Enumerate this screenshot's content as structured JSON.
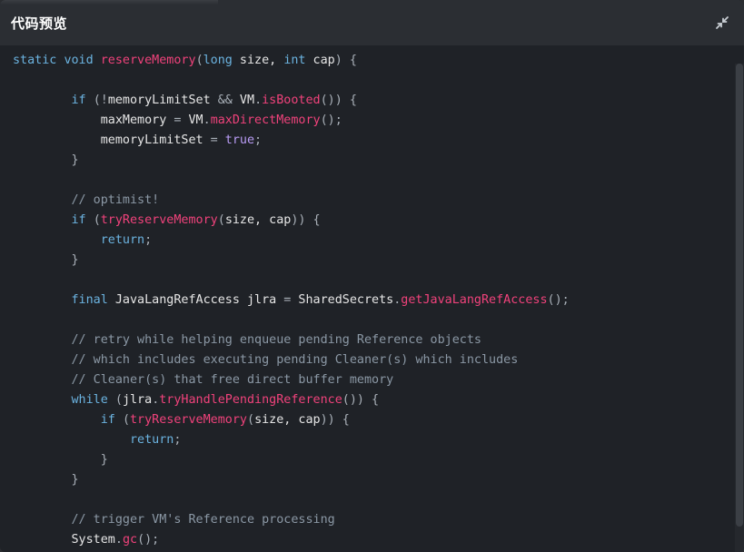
{
  "header": {
    "title": "代码预览",
    "fullscreen_icon": "collapse-arrows-icon"
  },
  "code": {
    "lines": [
      [
        [
          "kw",
          "static"
        ],
        [
          "pl",
          " "
        ],
        [
          "kw",
          "void"
        ],
        [
          "pl",
          " "
        ],
        [
          "fn",
          "reserveMemory"
        ],
        [
          "op",
          "("
        ],
        [
          "kw",
          "long"
        ],
        [
          "pl",
          " size, "
        ],
        [
          "kw",
          "int"
        ],
        [
          "pl",
          " cap"
        ],
        [
          "op",
          ") {"
        ]
      ],
      [],
      [
        [
          "pl",
          "        "
        ],
        [
          "kw",
          "if"
        ],
        [
          "pl",
          " "
        ],
        [
          "op",
          "(!"
        ],
        [
          "pl",
          "memoryLimitSet "
        ],
        [
          "op",
          "&&"
        ],
        [
          "pl",
          " VM"
        ],
        [
          "op",
          "."
        ],
        [
          "fn",
          "isBooted"
        ],
        [
          "op",
          "()) {"
        ]
      ],
      [
        [
          "pl",
          "            maxMemory "
        ],
        [
          "op",
          "="
        ],
        [
          "pl",
          " VM"
        ],
        [
          "op",
          "."
        ],
        [
          "fn",
          "maxDirectMemory"
        ],
        [
          "op",
          "();"
        ]
      ],
      [
        [
          "pl",
          "            memoryLimitSet "
        ],
        [
          "op",
          "="
        ],
        [
          "pl",
          " "
        ],
        [
          "lit",
          "true"
        ],
        [
          "op",
          ";"
        ]
      ],
      [
        [
          "pl",
          "        "
        ],
        [
          "op",
          "}"
        ]
      ],
      [],
      [
        [
          "pl",
          "        "
        ],
        [
          "cm",
          "// optimist!"
        ]
      ],
      [
        [
          "pl",
          "        "
        ],
        [
          "kw",
          "if"
        ],
        [
          "pl",
          " "
        ],
        [
          "op",
          "("
        ],
        [
          "fn",
          "tryReserveMemory"
        ],
        [
          "op",
          "("
        ],
        [
          "pl",
          "size, cap"
        ],
        [
          "op",
          ")) {"
        ]
      ],
      [
        [
          "pl",
          "            "
        ],
        [
          "kw",
          "return"
        ],
        [
          "op",
          ";"
        ]
      ],
      [
        [
          "pl",
          "        "
        ],
        [
          "op",
          "}"
        ]
      ],
      [],
      [
        [
          "pl",
          "        "
        ],
        [
          "kw",
          "final"
        ],
        [
          "pl",
          " JavaLangRefAccess jlra "
        ],
        [
          "op",
          "="
        ],
        [
          "pl",
          " SharedSecrets"
        ],
        [
          "op",
          "."
        ],
        [
          "fn",
          "getJavaLangRefAccess"
        ],
        [
          "op",
          "();"
        ]
      ],
      [],
      [
        [
          "pl",
          "        "
        ],
        [
          "cm",
          "// retry while helping enqueue pending Reference objects"
        ]
      ],
      [
        [
          "pl",
          "        "
        ],
        [
          "cm",
          "// which includes executing pending Cleaner(s) which includes"
        ]
      ],
      [
        [
          "pl",
          "        "
        ],
        [
          "cm",
          "// Cleaner(s) that free direct buffer memory"
        ]
      ],
      [
        [
          "pl",
          "        "
        ],
        [
          "kw",
          "while"
        ],
        [
          "pl",
          " "
        ],
        [
          "op",
          "("
        ],
        [
          "pl",
          "jlra"
        ],
        [
          "op",
          "."
        ],
        [
          "fn",
          "tryHandlePendingReference"
        ],
        [
          "op",
          "()) {"
        ]
      ],
      [
        [
          "pl",
          "            "
        ],
        [
          "kw",
          "if"
        ],
        [
          "pl",
          " "
        ],
        [
          "op",
          "("
        ],
        [
          "fn",
          "tryReserveMemory"
        ],
        [
          "op",
          "("
        ],
        [
          "pl",
          "size, cap"
        ],
        [
          "op",
          ")) {"
        ]
      ],
      [
        [
          "pl",
          "                "
        ],
        [
          "kw",
          "return"
        ],
        [
          "op",
          ";"
        ]
      ],
      [
        [
          "pl",
          "            "
        ],
        [
          "op",
          "}"
        ]
      ],
      [
        [
          "pl",
          "        "
        ],
        [
          "op",
          "}"
        ]
      ],
      [],
      [
        [
          "pl",
          "        "
        ],
        [
          "cm",
          "// trigger VM's Reference processing"
        ]
      ],
      [
        [
          "pl",
          "        System"
        ],
        [
          "op",
          "."
        ],
        [
          "fn",
          "gc"
        ],
        [
          "op",
          "();"
        ]
      ]
    ]
  },
  "colors": {
    "keyword": "#6bb3e0",
    "function": "#f0427b",
    "comment": "#8b98a5",
    "literal": "#b99cf5",
    "background": "#1f2227"
  }
}
